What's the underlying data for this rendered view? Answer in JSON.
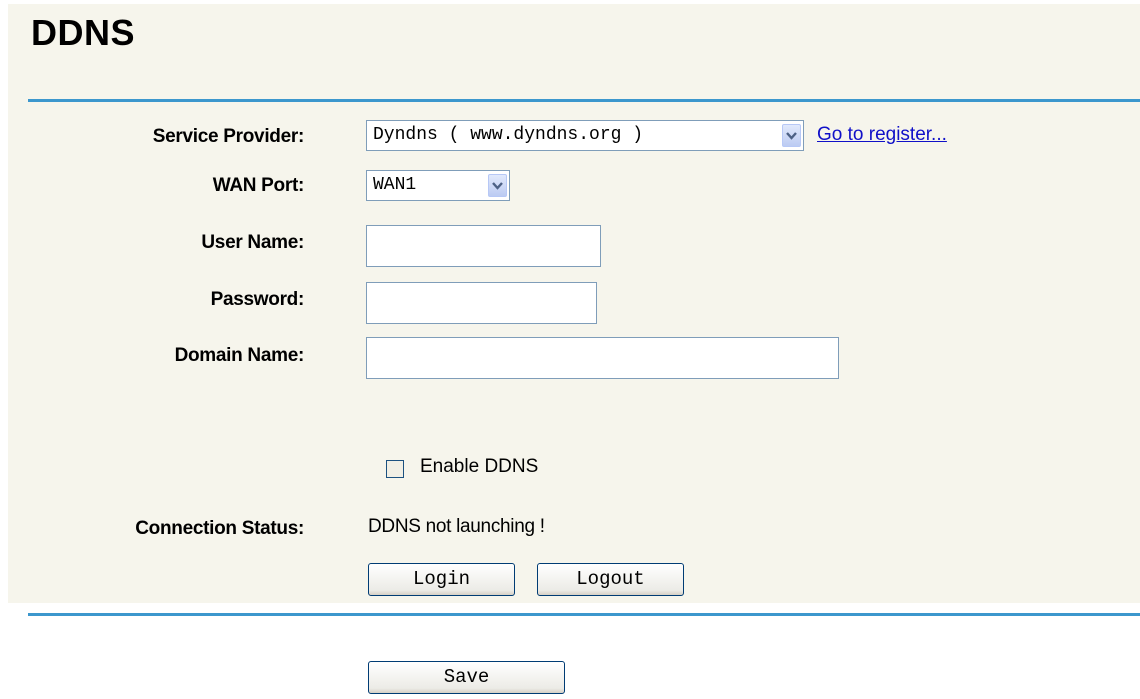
{
  "page": {
    "title": "DDNS"
  },
  "form": {
    "service_provider": {
      "label": "Service Provider:",
      "selected": "Dyndns ( www.dyndns.org )",
      "register_link": "Go to register..."
    },
    "wan_port": {
      "label": "WAN Port:",
      "selected": "WAN1"
    },
    "user_name": {
      "label": "User Name:",
      "value": ""
    },
    "password": {
      "label": "Password:",
      "value": ""
    },
    "domain_name": {
      "label": "Domain Name:",
      "value": ""
    },
    "enable_ddns": {
      "label": "Enable DDNS",
      "checked": false
    },
    "connection_status": {
      "label": "Connection Status:",
      "value": "DDNS not launching !"
    },
    "buttons": {
      "login": "Login",
      "logout": "Logout"
    }
  },
  "footer": {
    "save": "Save"
  },
  "colors": {
    "rule": "#3c97cd",
    "panel_bg": "#f6f5ec",
    "link": "#1010c8"
  },
  "icons": {
    "dropdown": "chevron-down-icon"
  }
}
